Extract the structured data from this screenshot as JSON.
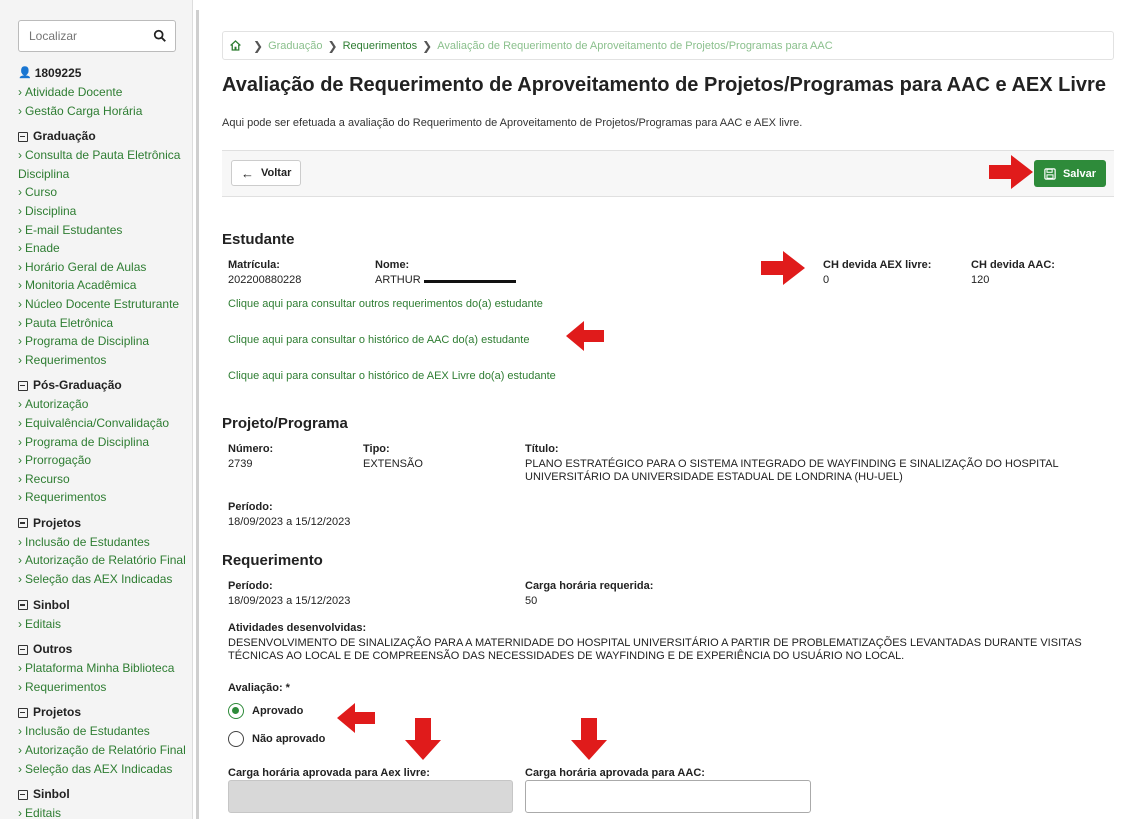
{
  "search": {
    "placeholder": "Localizar"
  },
  "sidebar": {
    "groups": [
      {
        "title": "1809225",
        "icon": "user-icon",
        "items": [
          "Atividade Docente",
          "Gestão Carga Horária"
        ]
      },
      {
        "title": "Graduação",
        "icon": "collapse-icon",
        "items": [
          "Consulta de Pauta Eletrônica Disciplina",
          "Curso",
          "Disciplina",
          "E-mail Estudantes",
          "Enade",
          "Horário Geral de Aulas",
          "Monitoria Acadêmica",
          "Núcleo Docente Estruturante",
          "Pauta Eletrônica",
          "Programa de Disciplina",
          "Requerimentos"
        ]
      },
      {
        "title": "Pós-Graduação",
        "icon": "collapse-icon",
        "items": [
          "Autorização",
          "Equivalência/Convalidação",
          "Programa de Disciplina",
          "Prorrogação",
          "Recurso",
          "Requerimentos"
        ]
      },
      {
        "title": "Projetos",
        "icon": "collapse-icon",
        "items": [
          "Inclusão de Estudantes",
          "Autorização de Relatório Final",
          "Seleção das AEX Indicadas"
        ]
      },
      {
        "title": "Sinbol",
        "icon": "collapse-icon",
        "items": [
          "Editais"
        ]
      },
      {
        "title": "Outros",
        "icon": "collapse-icon",
        "items": [
          "Plataforma Minha Biblioteca",
          "Requerimentos"
        ]
      },
      {
        "title": "Projetos",
        "icon": "collapse-icon",
        "items": [
          "Inclusão de Estudantes",
          "Autorização de Relatório Final",
          "Seleção das AEX Indicadas"
        ]
      },
      {
        "title": "Sinbol",
        "icon": "collapse-icon",
        "items": [
          "Editais"
        ]
      }
    ]
  },
  "breadcrumb": {
    "items": [
      "Graduação",
      "Requerimentos",
      "Avaliação de Requerimento de Aproveitamento de Projetos/Programas para AAC"
    ]
  },
  "page": {
    "title": "Avaliação de Requerimento de Aproveitamento de Projetos/Programas para AAC e AEX Livre",
    "description": "Aqui pode ser efetuada a avaliação do Requerimento de Aproveitamento de Projetos/Programas para AAC e AEX livre."
  },
  "toolbar": {
    "back_label": "Voltar",
    "save_label": "Salvar"
  },
  "estudante": {
    "section_title": "Estudante",
    "matricula_label": "Matrícula:",
    "matricula": "202200880228",
    "nome_label": "Nome:",
    "nome": "ARTHUR",
    "ch_aex_label": "CH devida AEX livre:",
    "ch_aex": "0",
    "ch_aac_label": "CH devida AAC:",
    "ch_aac": "120",
    "link_requerimentos": "Clique aqui para consultar outros requerimentos do(a) estudante",
    "link_aac": "Clique aqui para consultar o histórico de AAC do(a) estudante",
    "link_aex": "Clique aqui para consultar o histórico de AEX Livre do(a) estudante"
  },
  "projeto": {
    "section_title": "Projeto/Programa",
    "numero_label": "Número:",
    "numero": "2739",
    "tipo_label": "Tipo:",
    "tipo": "EXTENSÃO",
    "titulo_label": "Título:",
    "titulo": "PLANO ESTRATÉGICO PARA O SISTEMA INTEGRADO DE WAYFINDING E SINALIZAÇÃO DO HOSPITAL UNIVERSITÁRIO DA UNIVERSIDADE ESTADUAL DE LONDRINA (HU-UEL)",
    "periodo_label": "Período:",
    "periodo": "18/09/2023 a 15/12/2023"
  },
  "requerimento": {
    "section_title": "Requerimento",
    "periodo_label": "Período:",
    "periodo": "18/09/2023 a 15/12/2023",
    "carga_label": "Carga horária requerida:",
    "carga": "50",
    "atividades_label": "Atividades desenvolvidas:",
    "atividades": "DESENVOLVIMENTO DE SINALIZAÇÃO PARA A MATERNIDADE DO HOSPITAL UNIVERSITÁRIO A PARTIR DE PROBLEMATIZAÇÕES LEVANTADAS DURANTE VISITAS TÉCNICAS AO LOCAL E DE COMPREENSÃO DAS NECESSIDADES DE WAYFINDING E DE EXPERIÊNCIA DO USUÁRIO NO LOCAL.",
    "avaliacao_label": "Avaliação: *",
    "opt_aprovado": "Aprovado",
    "opt_nao_aprovado": "Não aprovado",
    "selected": "Aprovado",
    "ch_aex_aprovada_label": "Carga horária aprovada para Aex livre:",
    "ch_aac_aprovada_label": "Carga horária aprovada para AAC:"
  },
  "colors": {
    "accent_green": "#2e7d32",
    "save_button": "#2e8b3a",
    "annotation_red": "#e01b1b"
  }
}
